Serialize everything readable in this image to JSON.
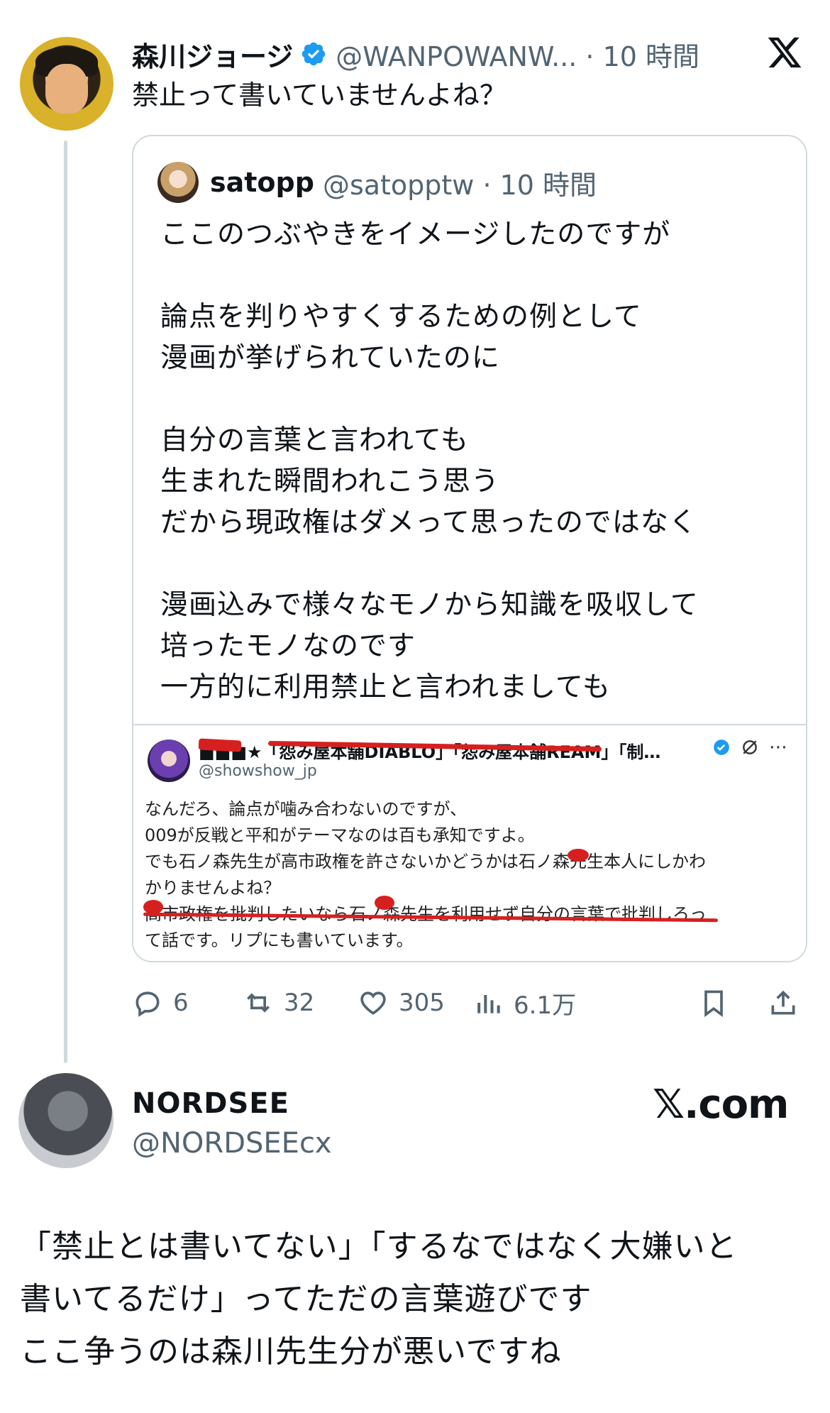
{
  "post": {
    "display_name": "森川ジョージ",
    "handle_time": "@WANPOWANW... · 10 時間",
    "text": "禁止って書いていませんよね？",
    "brand_icon": "x-logo-icon"
  },
  "quote": {
    "display_name": "satopp",
    "handle_time": "@satopptw · 10 時間",
    "lines": [
      "ここのつぶやきをイメージしたのですが",
      "",
      "論点を判りやすくするための例として",
      "漫画が挙げられていたのに",
      "",
      "自分の言葉と言われても",
      "生まれた瞬間われこう思う",
      "だから現政権はダメって思ったのではなく",
      "",
      "漫画込みで様々なモノから知識を吸収して",
      "培ったモノなのです",
      "一方的に利用禁止と言われましても"
    ],
    "screenshot": {
      "header": "■■■★「怨み屋本舗DIABLO」「怨み屋本舗REAM」「制…",
      "handle": "@showshow_jp",
      "lines": [
        "なんだろ、論点が噛み合わないのですが、",
        "009が反戦と平和がテーマなのは百も承知ですよ。",
        "でも石ノ森先生が高市政権を許さないかどうかは石ノ森先生本人にしかわ",
        "かりませんよね？",
        "高市政権を批判したいなら石ノ森先生を利用せず自分の言葉で批判しろっ",
        "て話です。リプにも書いています。"
      ],
      "menu": "⋯"
    }
  },
  "actions": {
    "replies": "6",
    "reposts": "32",
    "likes": "305",
    "views": "6.1万"
  },
  "reply": {
    "display_name": "NORDSEE",
    "handle": "@NORDSEEcx",
    "site": "𝕏.com",
    "lines": [
      "「禁止とは書いてない」「するなではなく大嫌いと",
      "書いてるだけ」ってただの言葉遊びです",
      "ここ争うのは森川先生分が悪いですね"
    ]
  },
  "colors": {
    "verified": "#1d9bf0",
    "muted": "#536471",
    "border": "#cfd9de",
    "red_mark": "#d62020"
  }
}
